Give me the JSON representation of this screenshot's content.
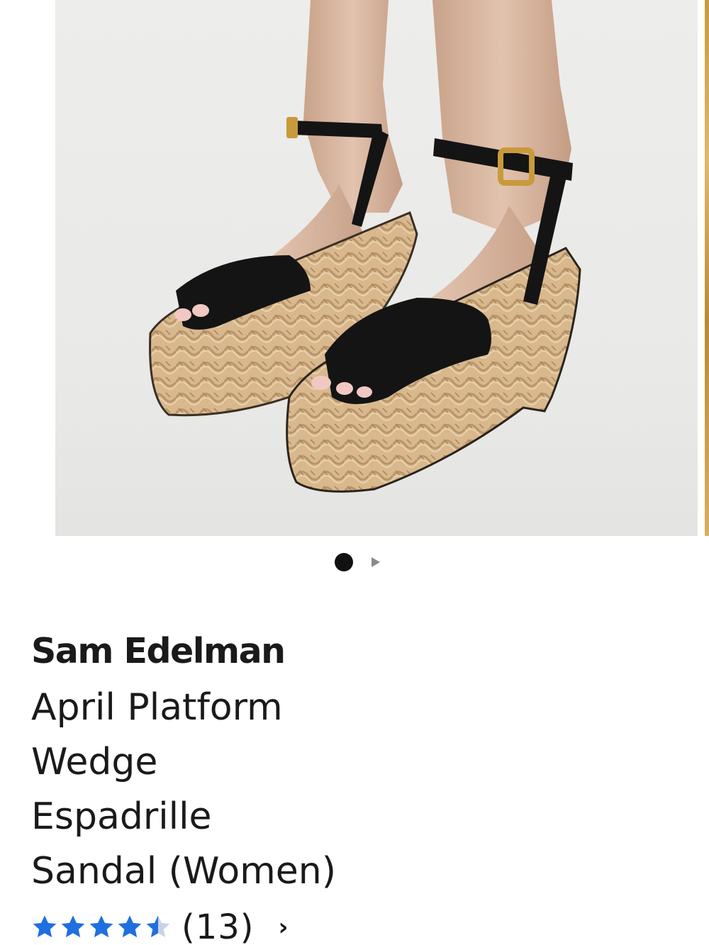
{
  "carousel": {
    "image_alt": "Black suede ankle-strap sandals on braided raffia platform wedges",
    "slide_count": 2,
    "active_index": 0
  },
  "product": {
    "brand": "Sam Edelman",
    "title_lines": [
      "April Platform",
      "Wedge",
      "Espadrille",
      "Sandal (Women)"
    ],
    "rating_value": 4.5,
    "rating_max": 5,
    "review_count": "(13)"
  },
  "colors": {
    "star": "#1f6fe0",
    "star_empty": "#c9d3e4",
    "text": "#1a1a1a"
  },
  "icons": {
    "next_slide": "play-triangle-icon",
    "reviews_link": "chevron-right-icon"
  }
}
